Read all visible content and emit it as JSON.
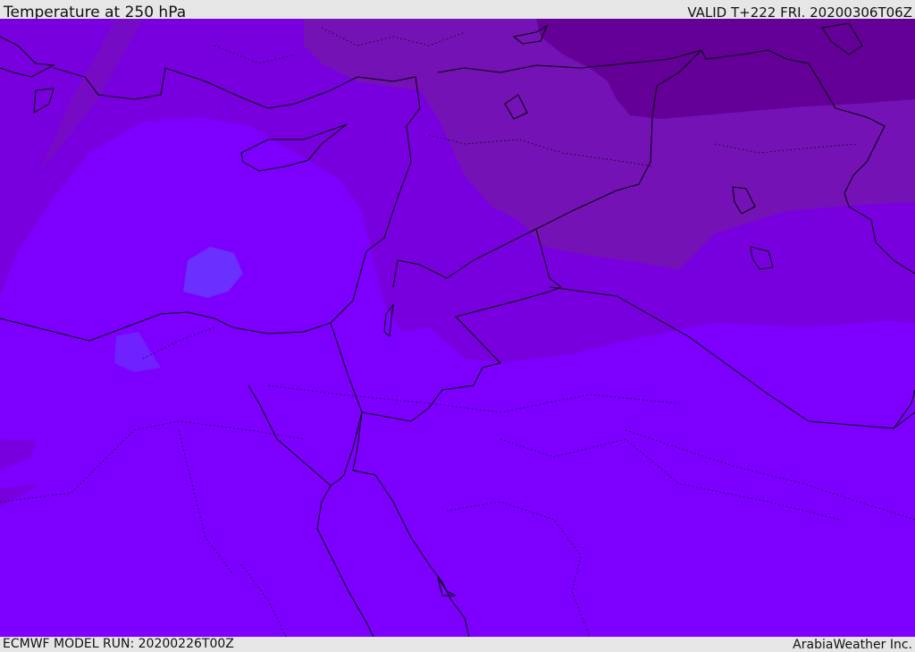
{
  "header": {
    "title": "Temperature at 250 hPa",
    "valid": "VALID T+222 FRI. 20200306T06Z"
  },
  "footer": {
    "model_run": "ECMWF MODEL RUN: 20200226T00Z",
    "brand": "ArabiaWeather Inc."
  },
  "colors": {
    "base": "#7d00ff",
    "band_mid": "#7800de",
    "band_upper": "#7412b6",
    "band_top": "#640098",
    "cold_blob": "#6a30ff",
    "coast": "#000000"
  }
}
